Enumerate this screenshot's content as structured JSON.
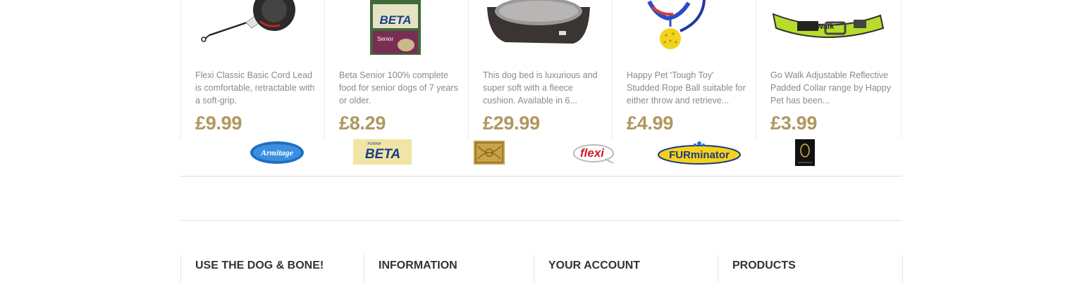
{
  "products": [
    {
      "desc": "Flexi Classic Basic Cord Lead is comfortable, retractable with a soft-grip.",
      "price": "£9.99",
      "image_icon": "retractable-lead-image"
    },
    {
      "desc": "Beta Senior 100% complete food for senior dogs of 7 years or older.",
      "price": "£8.29",
      "image_icon": "beta-senior-bag-image",
      "bag_brand": "BETA",
      "bag_label": "Senior"
    },
    {
      "desc": "This dog bed is luxurious and super soft with a fleece cushion. Available in 6...",
      "price": "£29.99",
      "image_icon": "dog-bed-image"
    },
    {
      "desc": "Happy Pet 'Tough Toy' Studded Rope Ball suitable for either throw and retrieve...",
      "price": "£4.99",
      "image_icon": "rope-ball-toy-image"
    },
    {
      "desc": "Go Walk Adjustable Reflective Padded Collar range by Happy Pet has been...",
      "price": "£3.99",
      "image_icon": "reflective-collar-image",
      "collar_text": "Go:Walk"
    }
  ],
  "brands": [
    {
      "name": "Armitage",
      "icon": "armitage-logo"
    },
    {
      "name": "BETA",
      "icon": "beta-logo",
      "subtext": "PURINA"
    },
    {
      "name": "Celtic knot brand",
      "icon": "celtic-knot-logo"
    },
    {
      "name": "flexi",
      "icon": "flexi-logo"
    },
    {
      "name": "FURminator",
      "icon": "furminator-logo"
    },
    {
      "name": "Hyper Pet",
      "icon": "hyper-pet-logo"
    }
  ],
  "footer": {
    "col1": "USE THE DOG & BONE!",
    "col2": "INFORMATION",
    "col3": "YOUR ACCOUNT",
    "col4": "PRODUCTS"
  },
  "colors": {
    "price": "#b09660",
    "desc": "#8a8a8a",
    "heading": "#333333"
  }
}
